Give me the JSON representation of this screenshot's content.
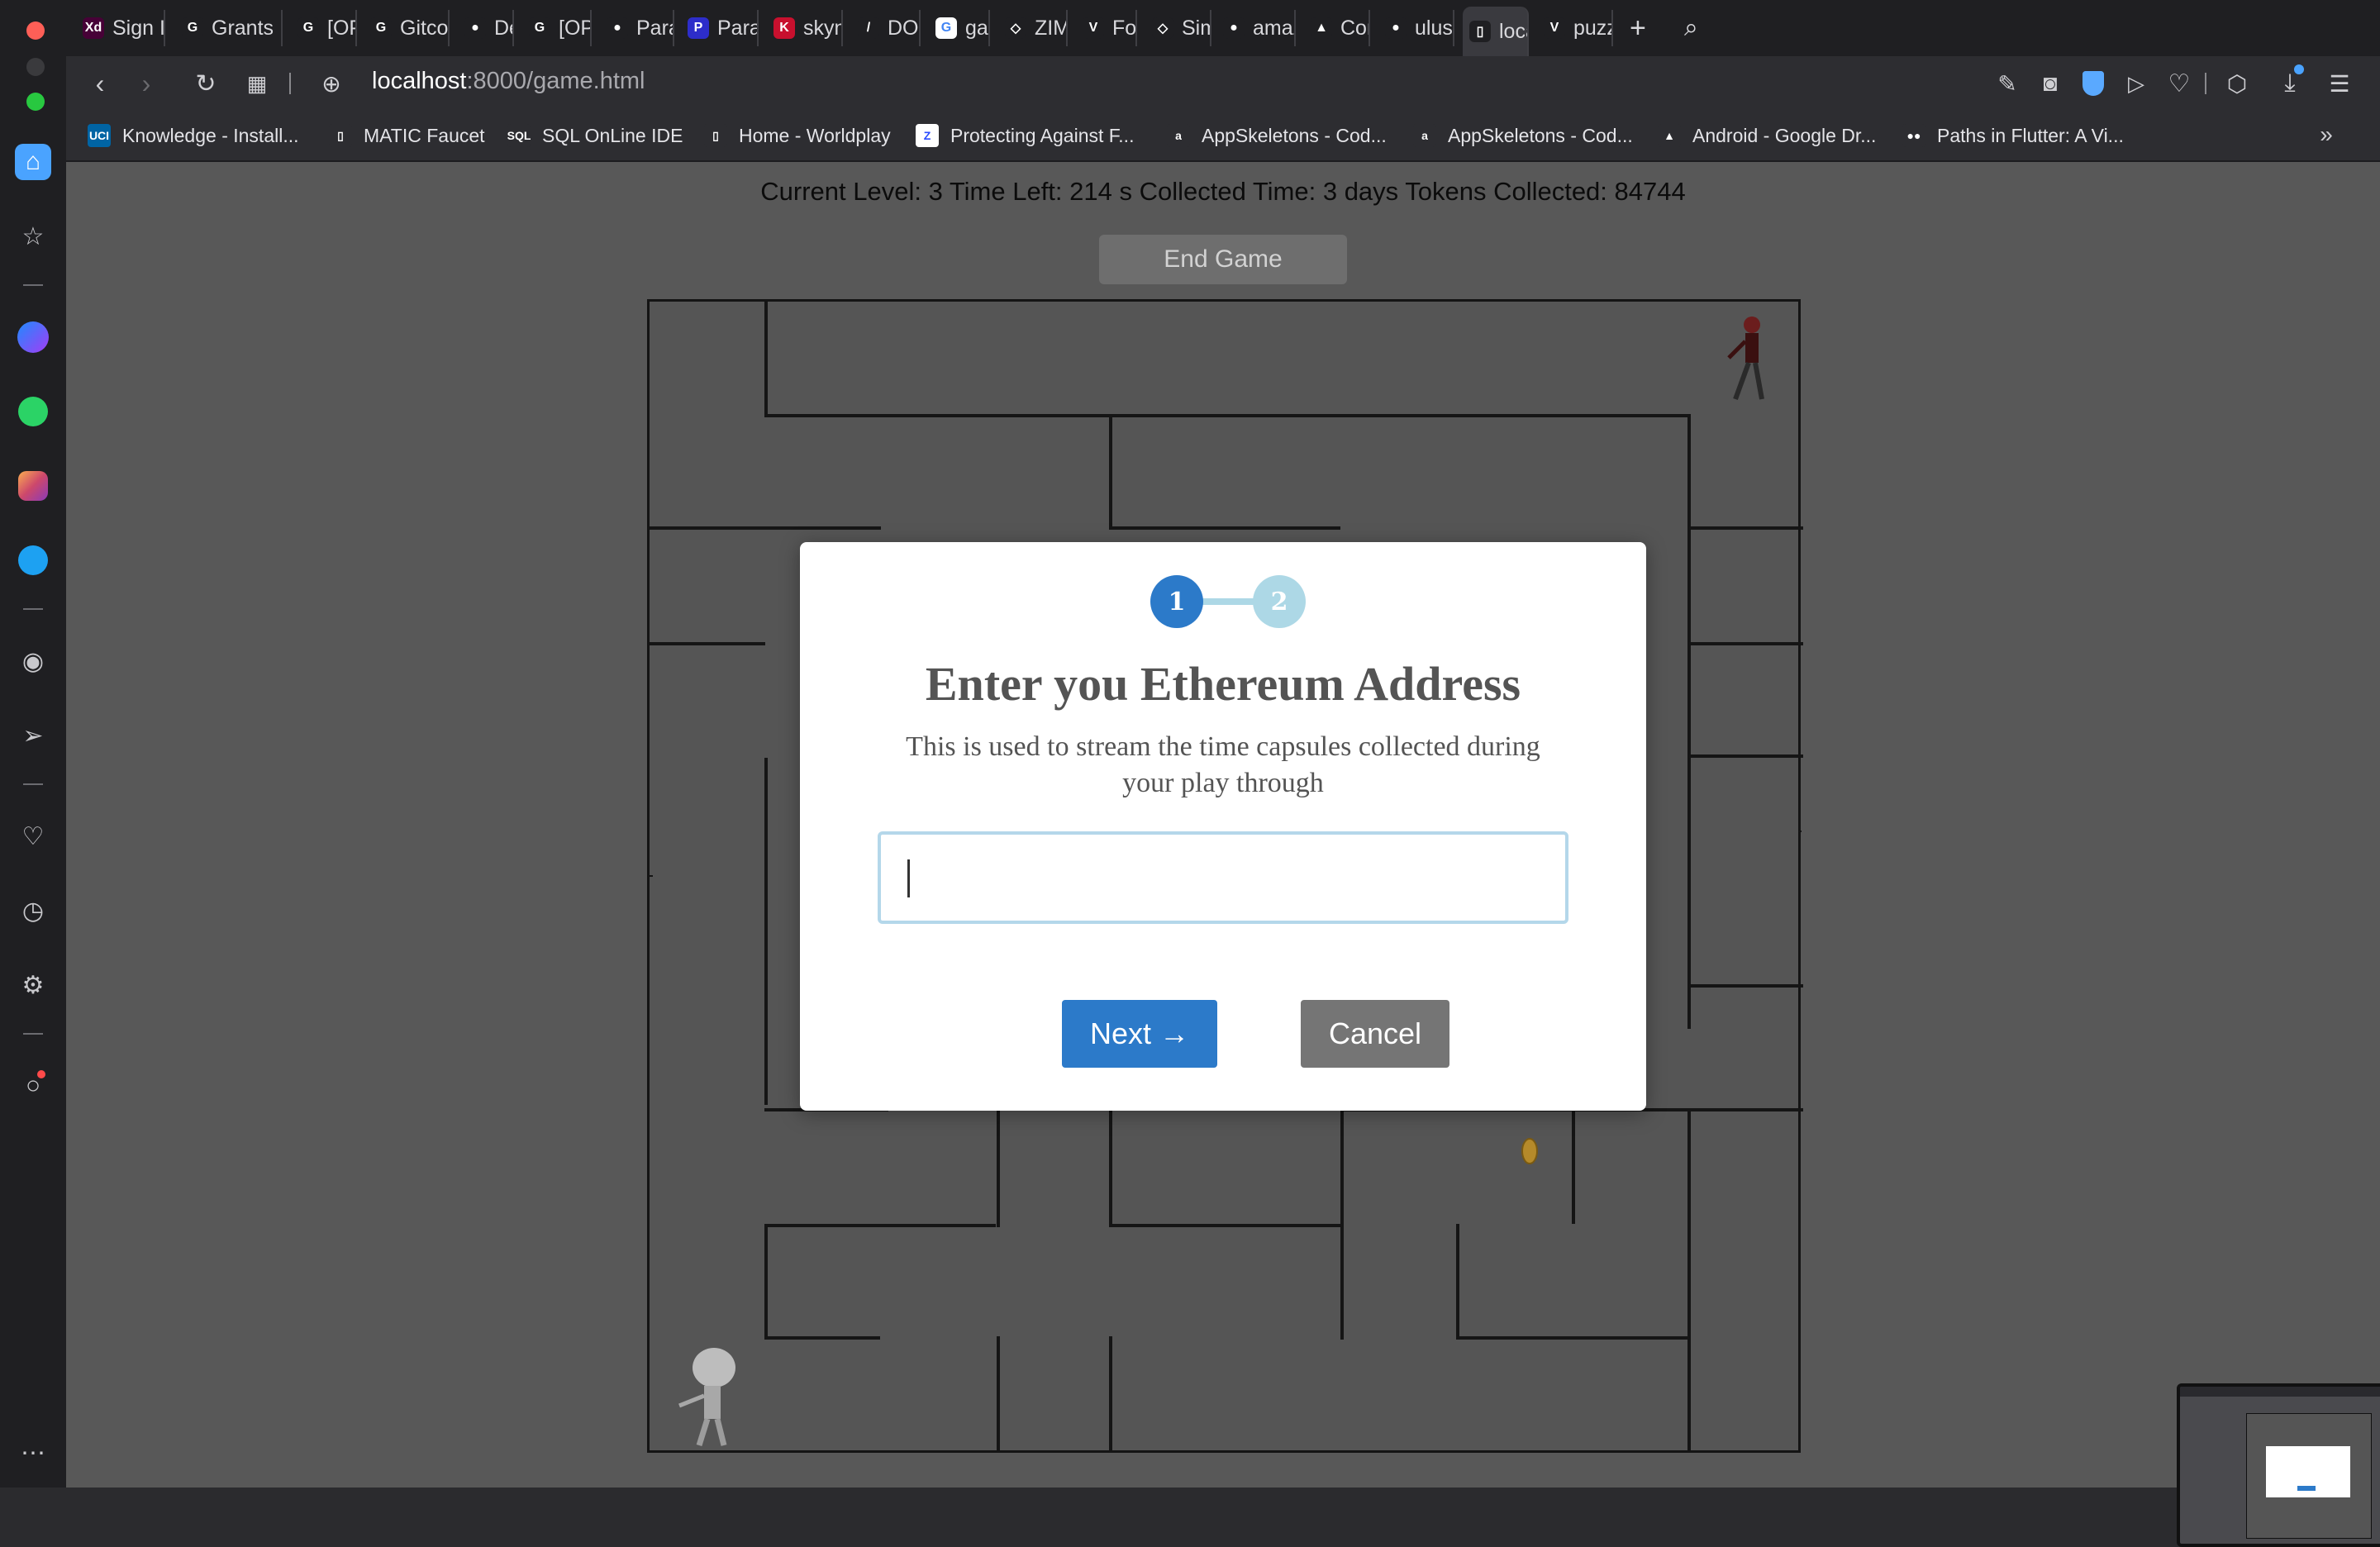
{
  "tabs": [
    {
      "label": "Sign In",
      "icon": "xd-icon",
      "color": "#470137",
      "glyph": "Xd"
    },
    {
      "label": "Grants",
      "icon": "gitcoin-icon",
      "color": "#1f1f22",
      "glyph": "G"
    },
    {
      "label": "[OPGam",
      "icon": "gitcoin-icon",
      "color": "#1f1f22",
      "glyph": "G"
    },
    {
      "label": "Gitcoin",
      "icon": "gitcoin-icon",
      "color": "#1f1f22",
      "glyph": "G"
    },
    {
      "label": "Develo",
      "icon": "github-icon",
      "color": "#1f1f22",
      "glyph": "●"
    },
    {
      "label": "[OPGam",
      "icon": "gitcoin-icon",
      "color": "#1f1f22",
      "glyph": "G"
    },
    {
      "label": "Paras",
      "icon": "github-icon",
      "color": "#1f1f22",
      "glyph": "●"
    },
    {
      "label": "Paras -",
      "icon": "paras-icon",
      "color": "#2d2dca",
      "glyph": "P"
    },
    {
      "label": "skynet",
      "icon": "skynet-icon",
      "color": "#c8102e",
      "glyph": "K"
    },
    {
      "label": "DOCS",
      "icon": "docs-icon",
      "color": "#1f1f22",
      "glyph": "/"
    },
    {
      "label": "game s",
      "icon": "google-icon",
      "color": "#ffffff",
      "glyph": "G"
    },
    {
      "label": "ZIM Cr",
      "icon": "codepen-icon",
      "color": "#1f1f22",
      "glyph": "◇"
    },
    {
      "label": "Form c",
      "icon": "vuetify-icon",
      "color": "#1f1f22",
      "glyph": "V"
    },
    {
      "label": "Simple",
      "icon": "codepen-icon",
      "color": "#1f1f22",
      "glyph": "◇"
    },
    {
      "label": "amazei",
      "icon": "github-icon",
      "color": "#1f1f22",
      "glyph": "●"
    },
    {
      "label": "Config",
      "icon": "config-icon",
      "color": "#1f1f22",
      "glyph": "▲"
    },
    {
      "label": "ulusoyo",
      "icon": "github-icon",
      "color": "#1f1f22",
      "glyph": "●"
    },
    {
      "label": "localho",
      "icon": "page-icon",
      "color": "#1f1f22",
      "glyph": "▯"
    },
    {
      "label": "puzzle",
      "icon": "vue-icon",
      "color": "#1f1f22",
      "glyph": "V"
    }
  ],
  "address": {
    "host": "localhost",
    "path": ":8000/game.html"
  },
  "bookmarks": [
    {
      "label": "Knowledge - Install...",
      "icon": "uci-icon",
      "glyph": "UCI",
      "color": "#0064a4"
    },
    {
      "label": "MATIC Faucet",
      "icon": "page-icon",
      "glyph": "▯",
      "color": "#2d2d31"
    },
    {
      "label": "SQL OnLine IDE",
      "icon": "sql-icon",
      "glyph": "SQL",
      "color": "#2d2d31"
    },
    {
      "label": "Home - Worldplay",
      "icon": "page-icon",
      "glyph": "▯",
      "color": "#2d2d31"
    },
    {
      "label": "Protecting Against F...",
      "icon": "z-icon",
      "glyph": "Z",
      "color": "#ffffff"
    },
    {
      "label": "AppSkeletons - Cod...",
      "icon": "amazon-icon",
      "glyph": "a",
      "color": "#2d2d31"
    },
    {
      "label": "AppSkeletons - Cod...",
      "icon": "amazon-icon",
      "glyph": "a",
      "color": "#2d2d31"
    },
    {
      "label": "Android - Google Dr...",
      "icon": "drive-icon",
      "glyph": "▲",
      "color": "#2d2d31"
    },
    {
      "label": "Paths in Flutter: A Vi...",
      "icon": "medium-icon",
      "glyph": "●●",
      "color": "#2d2d31"
    }
  ],
  "game": {
    "status": "Current Level: 3  Time Left: 214 s Collected Time: 3 days Tokens Collected: 84744",
    "end_game_label": "End Game"
  },
  "modal": {
    "step1": "1",
    "step2": "2",
    "title": "Enter you Ethereum Address",
    "description": "This is used to stream the time capsules collected during your play through",
    "input_value": "",
    "next_label": "Next →",
    "cancel_label": "Cancel"
  },
  "colors": {
    "accent": "#2c7ac9",
    "step_inactive": "#add8e6",
    "cancel": "#757575",
    "maze_bg": "#555555"
  }
}
